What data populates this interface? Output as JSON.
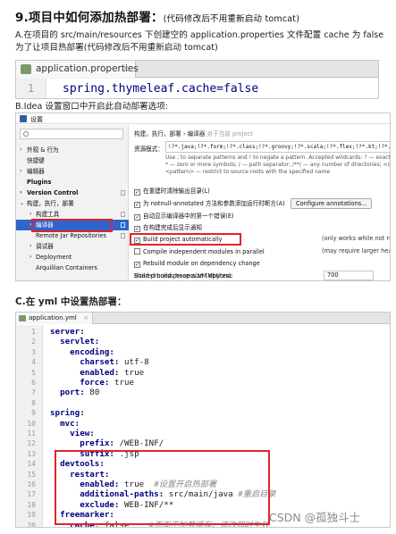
{
  "heading": {
    "title": "9.项目中如何添加热部署：",
    "note": "(代码修改后不用重新启动 tomcat)"
  },
  "step_a": "A.在项目的 src/main/resources 下创建空的 application.properties 文件配置 cache 为 false 为了让项目热部署(代码修改后不用重新启动 tomcat)",
  "properties_editor": {
    "tab_label": "application.properties",
    "close_glyph": "×",
    "line_number": "1",
    "code": "spring.thymeleaf.cache=false"
  },
  "step_b": "B.Idea 设置窗口中开启此自动部署选项:",
  "settings_dialog": {
    "title": "设置",
    "nav_items": [
      {
        "label": "外观 & 行为"
      },
      {
        "label": "快捷键"
      },
      {
        "label": "编辑器"
      },
      {
        "label": "Plugins"
      },
      {
        "label": "Version Control"
      },
      {
        "label": "构建，执行，部署"
      },
      {
        "label": "构建工具"
      },
      {
        "label": "编译器"
      },
      {
        "label": "Remote Jar Repositories"
      },
      {
        "label": "调试器"
      },
      {
        "label": "Deployment"
      },
      {
        "label": "Arquillian Containers"
      }
    ],
    "breadcrumb": "构建，执行，部署  ›  编译器",
    "breadcrumb_note": "对于当前 project",
    "resource_label": "资源模式：",
    "resource_value": "!?*.java;!?*.form;!?*.class;!?*.groovy;!?*.scala;!?*.flex;!?*.kt;!?*.clj;!?*.aj",
    "resource_hint": "Use ; to separate patterns and ! to negate a pattern. Accepted wildcards: ? — exactly one symbol; * — zero or more symbols; / — path separator; /**/ — any number of directories; <dir_name>: <pattern> — restrict to source roots with the specified name",
    "options": [
      {
        "label": "在重建时清除输出目录(L)",
        "checked": true
      },
      {
        "label": "为 notnull-annotated 方法和参数添加运行时断言(A)",
        "checked": true
      },
      {
        "label": "自动显示编译器中的第一个错误(E)",
        "checked": true
      },
      {
        "label": "在构建完成后显示通知",
        "checked": true
      },
      {
        "label": "Build project automatically",
        "checked": true
      },
      {
        "label": "Compile independent modules in parallel",
        "checked": false
      },
      {
        "label": "Rebuild module on dependency change",
        "checked": true
      }
    ],
    "configure_button": "Configure annotations...",
    "note_auto": "(only works while not running",
    "note_parallel": "(may require larger heap size)",
    "heap_label": "Build process heap size (Mbytes):",
    "heap_value": "700",
    "vm_label": "Shared build process VM options:"
  },
  "step_c": "C.在 yml 中设置热部署：",
  "yml_editor": {
    "tab_label": "application.yml",
    "close_glyph": "×",
    "lines": [
      {
        "n": "1",
        "indent": "",
        "key": "server:",
        "value": "",
        "comment": ""
      },
      {
        "n": "2",
        "indent": "  ",
        "key": "servlet:",
        "value": "",
        "comment": ""
      },
      {
        "n": "3",
        "indent": "    ",
        "key": "encoding:",
        "value": "",
        "comment": ""
      },
      {
        "n": "4",
        "indent": "      ",
        "key": "charset:",
        "value": " utf-8",
        "comment": ""
      },
      {
        "n": "5",
        "indent": "      ",
        "key": "enabled:",
        "value": " true",
        "comment": ""
      },
      {
        "n": "6",
        "indent": "      ",
        "key": "force:",
        "value": " true",
        "comment": ""
      },
      {
        "n": "7",
        "indent": "  ",
        "key": "port:",
        "value": " 80",
        "comment": ""
      },
      {
        "n": "8",
        "indent": "",
        "key": "",
        "value": "",
        "comment": ""
      },
      {
        "n": "9",
        "indent": "",
        "key": "spring:",
        "value": "",
        "comment": ""
      },
      {
        "n": "10",
        "indent": "  ",
        "key": "mvc:",
        "value": "",
        "comment": ""
      },
      {
        "n": "11",
        "indent": "    ",
        "key": "view:",
        "value": "",
        "comment": ""
      },
      {
        "n": "12",
        "indent": "      ",
        "key": "prefix:",
        "value": " /WEB-INF/",
        "comment": ""
      },
      {
        "n": "13",
        "indent": "      ",
        "key": "suffix:",
        "value": " .jsp",
        "comment": ""
      },
      {
        "n": "14",
        "indent": "  ",
        "key": "devtools:",
        "value": "",
        "comment": ""
      },
      {
        "n": "15",
        "indent": "    ",
        "key": "restart:",
        "value": "",
        "comment": ""
      },
      {
        "n": "16",
        "indent": "      ",
        "key": "enabled:",
        "value": " true  ",
        "comment": "#设置开启热部署"
      },
      {
        "n": "17",
        "indent": "      ",
        "key": "additional-paths:",
        "value": " src/main/java ",
        "comment": "#重启目录"
      },
      {
        "n": "18",
        "indent": "      ",
        "key": "exclude:",
        "value": " WEB-INF/**",
        "comment": ""
      },
      {
        "n": "19",
        "indent": "  ",
        "key": "freemarker:",
        "value": "",
        "comment": ""
      },
      {
        "n": "20",
        "indent": "    ",
        "key": "cache:",
        "value": " false    ",
        "comment": "#页面不加载缓存，修改即时生效"
      }
    ]
  },
  "watermark": "CSDN @孤独斗士"
}
